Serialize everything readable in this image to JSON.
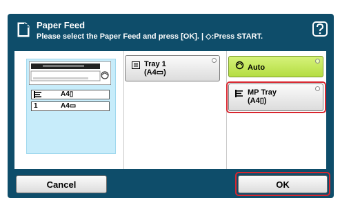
{
  "header": {
    "title": "Paper Feed",
    "subtitle": "Please select the Paper Feed and press [OK]. | ◇:Press START."
  },
  "preview": {
    "trays": [
      {
        "icon": "mp-tray-icon",
        "text": "A4▯"
      },
      {
        "icon": "tray-1-icon",
        "number": "1",
        "text": "A4▭"
      }
    ]
  },
  "options": {
    "tray1": {
      "line1": "Tray 1",
      "line2": "(A4▭)"
    },
    "auto": {
      "label": "Auto"
    },
    "mp_tray": {
      "line1": "MP Tray",
      "line2": "(A4▯)"
    }
  },
  "buttons": {
    "cancel": "Cancel",
    "ok": "OK"
  },
  "colors": {
    "frame": "#0e4d6a",
    "auto_active": "#c8ec5a",
    "highlight": "#d8262f",
    "preview_bg": "#c7ecfa"
  }
}
